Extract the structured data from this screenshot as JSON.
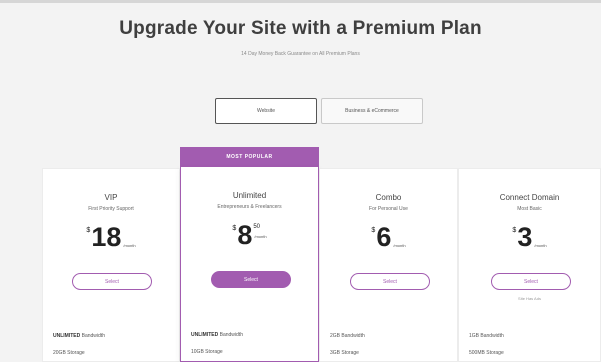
{
  "header": {
    "title": "Upgrade Your Site with a Premium Plan",
    "subtitle": "14 Day Money Back Guarantee on All Premium Plans"
  },
  "toggle": {
    "options": [
      "Website",
      "Business & eCommerce"
    ],
    "active": 0
  },
  "badge": "MOST POPULAR",
  "plans": [
    {
      "name": "VIP",
      "sub": "First Priority Support",
      "currency": "$",
      "amount": "18",
      "cents": "",
      "per": "/month",
      "button": "Select",
      "note": "",
      "features": [
        {
          "bold": "UNLIMITED",
          "text": " Bandwidth"
        },
        {
          "bold": "",
          "text": "20GB Storage"
        }
      ]
    },
    {
      "name": "Unlimited",
      "sub": "Entrepreneurs & Freelancers",
      "currency": "$",
      "amount": "8",
      "cents": "50",
      "per": "/month",
      "button": "Select",
      "note": "",
      "features": [
        {
          "bold": "UNLIMITED",
          "text": " Bandwidth"
        },
        {
          "bold": "",
          "text": "10GB Storage"
        }
      ]
    },
    {
      "name": "Combo",
      "sub": "For Personal Use",
      "currency": "$",
      "amount": "6",
      "cents": "",
      "per": "/month",
      "button": "Select",
      "note": "",
      "features": [
        {
          "bold": "",
          "text": "2GB Bandwidth"
        },
        {
          "bold": "",
          "text": "3GB Storage"
        }
      ]
    },
    {
      "name": "Connect Domain",
      "sub": "Most Basic",
      "currency": "$",
      "amount": "3",
      "cents": "",
      "per": "/month",
      "button": "Select",
      "note": "Site Has Ads",
      "features": [
        {
          "bold": "",
          "text": "1GB Bandwidth"
        },
        {
          "bold": "",
          "text": "500MB Storage"
        }
      ]
    }
  ],
  "colors": {
    "accent": "#a25cb0",
    "background": "#f3f3f3"
  }
}
